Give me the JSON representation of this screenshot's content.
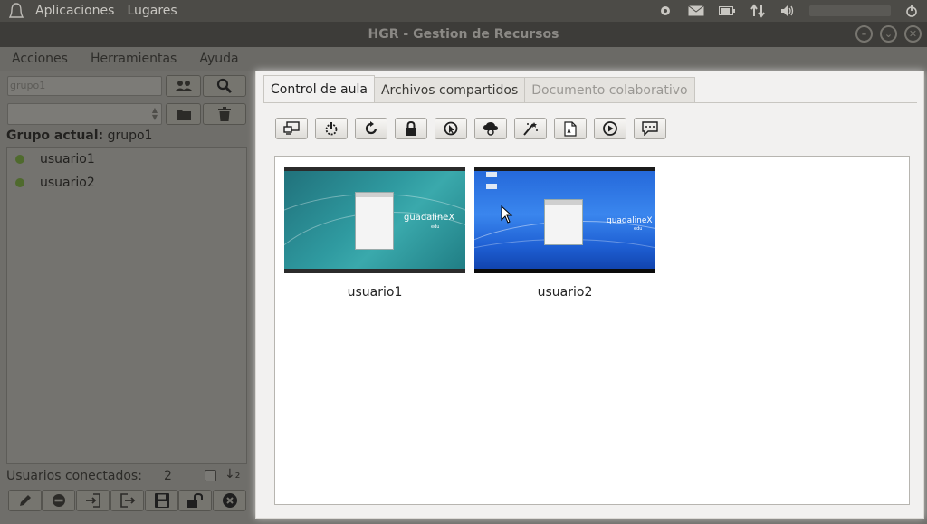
{
  "system_panel": {
    "logo_icon": "ubuntu-logo-icon",
    "menus": [
      "Aplicaciones",
      "Lugares"
    ],
    "indicators": [
      "settings-gear-icon",
      "mail-icon",
      "battery-icon",
      "network-arrows-icon",
      "volume-icon",
      "power-icon"
    ]
  },
  "window": {
    "title": "HGR - Gestion de Recursos"
  },
  "menubar": {
    "items": [
      "Acciones",
      "Herramientas",
      "Ayuda"
    ]
  },
  "left_pane": {
    "search_value": "grupo1",
    "group_label_prefix": "Grupo actual:",
    "group_name": "grupo1",
    "users": [
      "usuario1",
      "usuario2"
    ],
    "connected_label": "Usuarios conectados:",
    "connected_count": "2",
    "sort_icon_glyph": "↓₂"
  },
  "tabs": [
    "Control de aula",
    "Archivos compartidos",
    "Documento colaborativo"
  ],
  "toolbar_icons": [
    "monitor-icon",
    "power-icon",
    "reload-icon",
    "lock-icon",
    "cursor-icon",
    "cloud-icon",
    "magic-wand-icon",
    "document-icon",
    "play-icon",
    "chat-icon"
  ],
  "thumbnails": [
    {
      "label": "usuario1",
      "brand": "guadalineX",
      "brand_sub": "edu"
    },
    {
      "label": "usuario2",
      "brand": "guadalineX",
      "brand_sub": "edu"
    }
  ],
  "colors": {
    "dim_background": "#6f6e6a",
    "panel_background": "#f2f1f0",
    "user_status_dot": "#4f6a2d"
  }
}
